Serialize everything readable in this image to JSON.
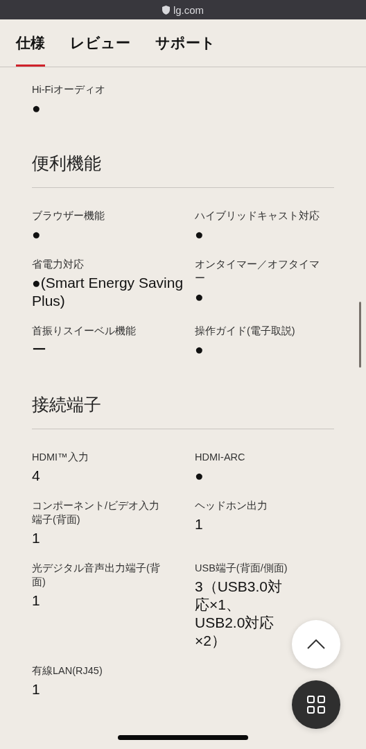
{
  "browser_bar": {
    "url": "lg.com"
  },
  "tabs": [
    {
      "label": "仕様",
      "selected": true
    },
    {
      "label": "レビュー",
      "selected": false
    },
    {
      "label": "サポート",
      "selected": false
    }
  ],
  "sections": [
    {
      "items": [
        {
          "label": "Hi-Fiオーディオ",
          "value": "●"
        }
      ]
    },
    {
      "title": "便利機能",
      "items": [
        {
          "label": "ブラウザー機能",
          "value": "●"
        },
        {
          "label": "ハイブリッドキャスト対応",
          "value": "●"
        },
        {
          "label": "省電力対応",
          "value": "●(Smart Energy Saving Plus)"
        },
        {
          "label": "オンタイマー／オフタイマー",
          "value": "●"
        },
        {
          "label": "首振りスイーベル機能",
          "value": "ー"
        },
        {
          "label": "操作ガイド(電子取説)",
          "value": "●"
        }
      ]
    },
    {
      "title": "接続端子",
      "items": [
        {
          "label": "HDMI™入力",
          "value": "4"
        },
        {
          "label": "HDMI-ARC",
          "value": "●"
        },
        {
          "label": "コンポーネント/ビデオ入力端子(背面)",
          "value": "1"
        },
        {
          "label": "ヘッドホン出力",
          "value": "1"
        },
        {
          "label": "光デジタル音声出力端子(背面)",
          "value": "1"
        },
        {
          "label": "USB端子(背面/側面)",
          "value": "3（USB3.0対応×1、USB2.0対応×2）"
        },
        {
          "label": "有線LAN(RJ45)",
          "value": "1"
        }
      ]
    }
  ]
}
